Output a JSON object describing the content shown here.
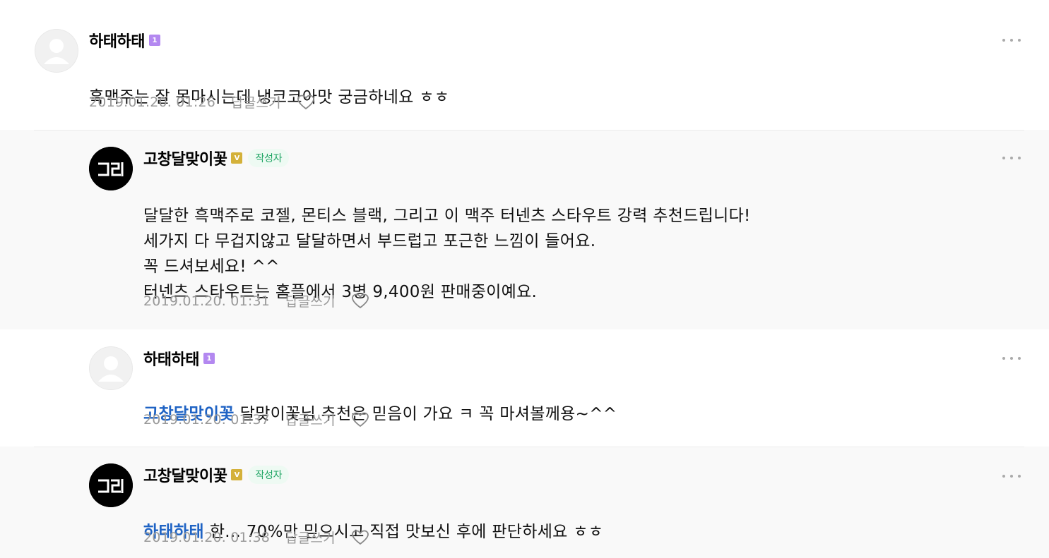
{
  "comments": [
    {
      "nickname": "하태하태",
      "level_badge": "1",
      "text": "흑맥주는 잘 못마시는데 냉코코아맛 궁금하네요 ㅎㅎ",
      "date": "2019.01.20. 01:26",
      "reply_label": "답글쓰기"
    },
    {
      "nickname": "고창달맞이꽃",
      "level_badge": "V",
      "author_badge": "작성자",
      "text": "달달한 흑맥주로 코젤, 몬티스 블랙, 그리고 이 맥주 터넨츠 스타우트 강력 추천드립니다!\n세가지 다 무겁지않고 달달하면서 부드럽고 포근한 느낌이 들어요.\n꼭 드셔보세요! ^^\n터넨츠 스타우트는 홈플에서 3병 9,400원 판매중이예요.",
      "date": "2019.01.20. 01:31",
      "reply_label": "답글쓰기"
    },
    {
      "nickname": "하태하태",
      "level_badge": "1",
      "mention": "고창달맞이꽃",
      "text": "달맞이꽃님 추천은 믿음이 가요 ㅋ 꼭 마셔볼께용~^^",
      "date": "2019.01.20. 01:37",
      "reply_label": "답글쓰기"
    },
    {
      "nickname": "고창달맞이꽃",
      "level_badge": "V",
      "author_badge": "작성자",
      "mention": "하태하태",
      "text": "한... 70%만 믿으시고 직접 맛보신 후에 판단하세요 ㅎㅎ",
      "date": "2019.01.20. 01:38",
      "reply_label": "답글쓰기"
    }
  ],
  "colors": {
    "mention": "#1f63c4",
    "author_badge_text": "#1fa564",
    "author_badge_bg": "#eefaf3",
    "reply_bg": "#f9f9f9",
    "meta": "#999999"
  },
  "icons": {
    "default_avatar": "default-profile-icon",
    "logo_avatar": "gochang-logo-icon",
    "heart": "heart-icon",
    "more": "more-options-icon"
  }
}
